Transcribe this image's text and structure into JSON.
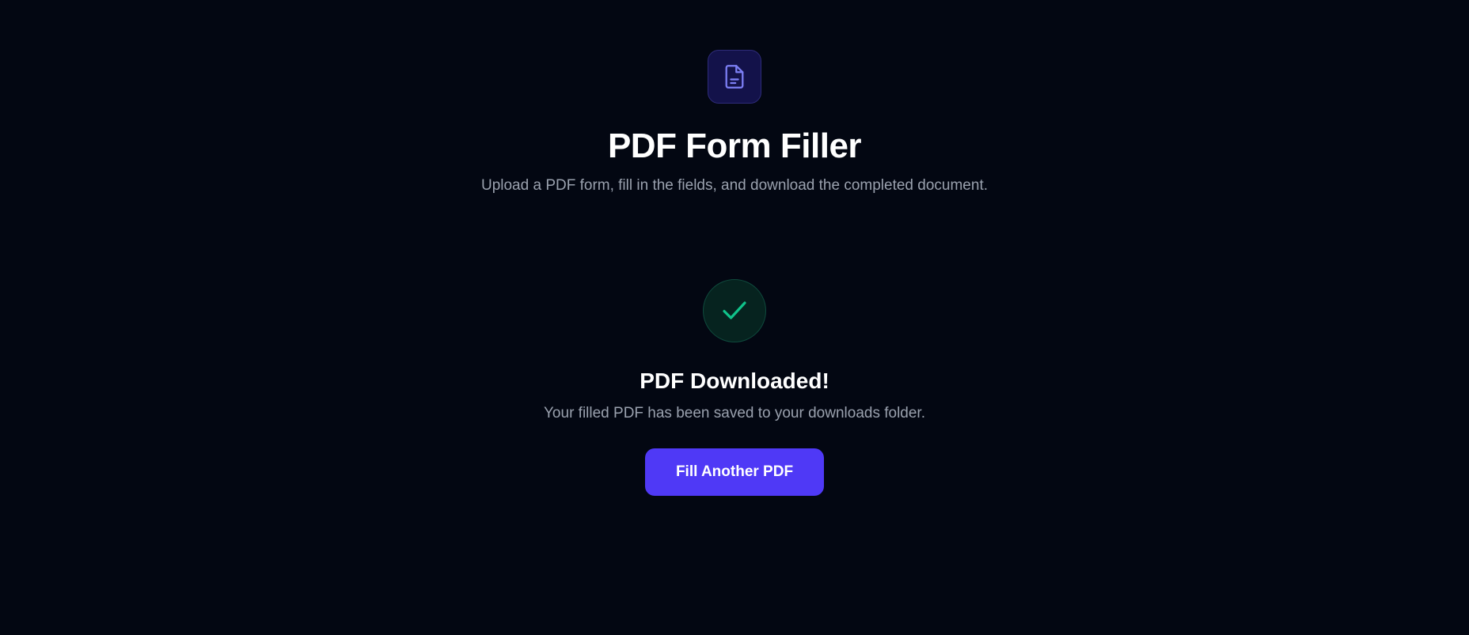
{
  "header": {
    "logo_icon": "file-text-icon",
    "title": "PDF Form Filler",
    "subtitle": "Upload a PDF form, fill in the fields, and download the completed document."
  },
  "success": {
    "icon": "check-icon",
    "title": "PDF Downloaded!",
    "message": "Your filled PDF has been saved to your downloads folder.",
    "button_label": "Fill Another PDF"
  },
  "colors": {
    "background": "#030712",
    "accent": "#4f39f6",
    "logo_icon": "#7c7ff5",
    "success": "#10c28a",
    "muted_text": "#9aa1ae"
  }
}
